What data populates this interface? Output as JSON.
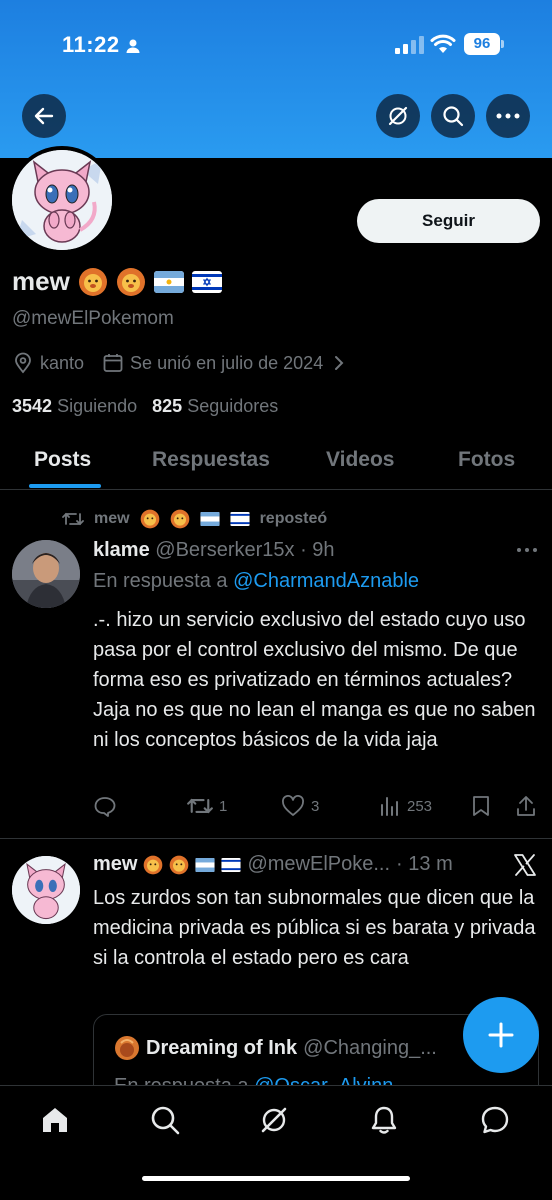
{
  "status_bar": {
    "time": "11:22",
    "battery": "96"
  },
  "profile": {
    "name": "mew",
    "handle": "@mewElPokemom",
    "location": "kanto",
    "joined": "Se unió en julio de 2024",
    "following_count": "3542",
    "following_label": "Siguiendo",
    "followers_count": "825",
    "followers_label": "Seguidores",
    "follow_label": "Seguir"
  },
  "tabs": [
    {
      "label": "Posts"
    },
    {
      "label": "Respuestas"
    },
    {
      "label": "Videos"
    },
    {
      "label": "Fotos"
    }
  ],
  "repost": {
    "user": "mew",
    "action": "reposteó"
  },
  "tweet1": {
    "name": "klame",
    "handle": "@Berserker15x",
    "time": "· 9h",
    "reply_prefix": "En respuesta a",
    "reply_handle": "@CharmandAznable",
    "text": ".-. hizo un servicio exclusivo del estado cuyo uso pasa por el control exclusivo del mismo. De que forma eso es privatizado en términos actuales? Jaja no es que no lean el manga es que no saben ni los conceptos básicos de la vida jaja",
    "retweets": "1",
    "likes": "3",
    "views": "253"
  },
  "tweet2": {
    "name": "mew",
    "handle": "@mewElPoke...",
    "time": "· 13 m",
    "text": "Los zurdos son tan subnormales que dicen que la medicina privada es pública si es barata y privada si la controla el estado pero es cara",
    "quote": {
      "name": "Dreaming of Ink",
      "handle": "@Changing_...",
      "reply_prefix": "En respuesta a",
      "reply_handle": "@Oscar_Alvinn"
    }
  },
  "colors": {
    "accent": "#1d9bf0",
    "banner": "#1d7fe0",
    "text": "#e7e9ea",
    "muted": "#71767b"
  },
  "icons": [
    "back-arrow-icon",
    "grok-icon",
    "search-icon",
    "more-icon",
    "location-icon",
    "calendar-icon",
    "chevron-right-icon",
    "retweet-icon",
    "reply-icon",
    "like-icon",
    "views-icon",
    "bookmark-icon",
    "share-icon",
    "x-logo-icon",
    "plus-icon",
    "home-icon",
    "notifications-icon",
    "messages-icon"
  ]
}
